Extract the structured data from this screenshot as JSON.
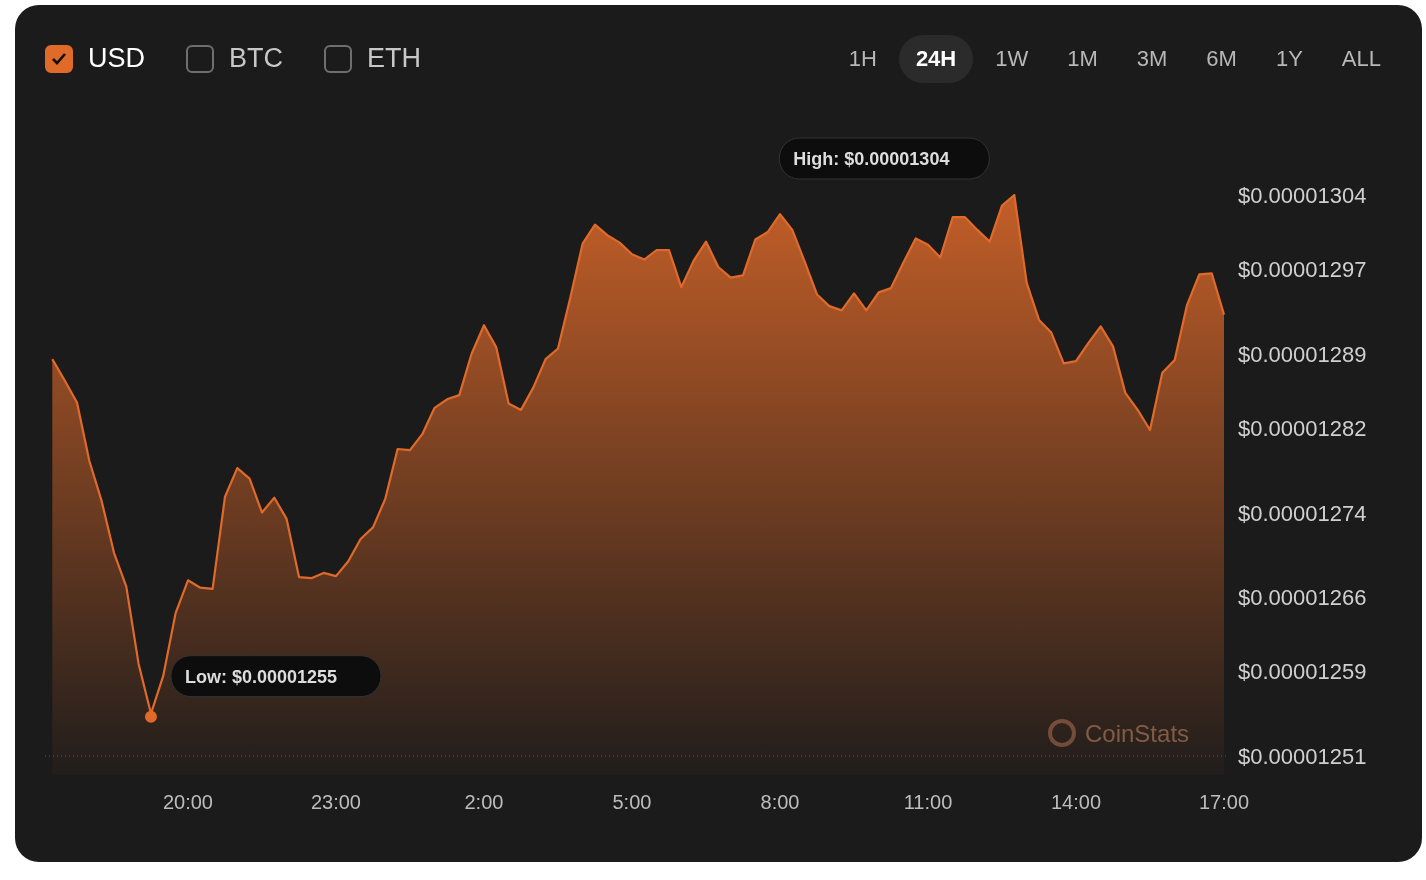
{
  "currencies": [
    {
      "label": "USD",
      "checked": true
    },
    {
      "label": "BTC",
      "checked": false
    },
    {
      "label": "ETH",
      "checked": false
    }
  ],
  "ranges": [
    {
      "label": "1H",
      "selected": false
    },
    {
      "label": "24H",
      "selected": true
    },
    {
      "label": "1W",
      "selected": false
    },
    {
      "label": "1M",
      "selected": false
    },
    {
      "label": "3M",
      "selected": false
    },
    {
      "label": "6M",
      "selected": false
    },
    {
      "label": "1Y",
      "selected": false
    },
    {
      "label": "ALL",
      "selected": false
    }
  ],
  "chart": {
    "watermark": "CoinStats",
    "chart_data": {
      "type": "area",
      "ylim": [
        1.251e-05,
        1.304e-05
      ],
      "categories": [
        null,
        null,
        null,
        null,
        null,
        null,
        null,
        null,
        null,
        null,
        null,
        "20:00",
        null,
        null,
        null,
        null,
        null,
        null,
        null,
        null,
        null,
        null,
        null,
        "23:00",
        null,
        null,
        null,
        null,
        null,
        null,
        null,
        null,
        null,
        null,
        null,
        "2:00",
        null,
        null,
        null,
        null,
        null,
        null,
        null,
        null,
        null,
        null,
        null,
        "5:00",
        null,
        null,
        null,
        null,
        null,
        null,
        null,
        null,
        null,
        null,
        null,
        "8:00",
        null,
        null,
        null,
        null,
        null,
        null,
        null,
        null,
        null,
        null,
        null,
        "11:00",
        null,
        null,
        null,
        null,
        null,
        null,
        null,
        null,
        null,
        null,
        null,
        "14:00",
        null,
        null,
        null,
        null,
        null,
        null,
        null,
        null,
        null,
        null,
        null,
        "17:00"
      ],
      "yticks": [
        {
          "value": 1.251e-05,
          "label": "$0.00001251"
        },
        {
          "value": 1.259e-05,
          "label": "$0.00001259"
        },
        {
          "value": 1.266e-05,
          "label": "$0.00001266"
        },
        {
          "value": 1.274e-05,
          "label": "$0.00001274"
        },
        {
          "value": 1.282e-05,
          "label": "$0.00001282"
        },
        {
          "value": 1.289e-05,
          "label": "$0.00001289"
        },
        {
          "value": 1.297e-05,
          "label": "$0.00001297"
        },
        {
          "value": 1.304e-05,
          "label": "$0.00001304"
        }
      ],
      "series": [
        {
          "color": "#e06a2a",
          "values": [
            1.2885e-05,
            1.2865e-05,
            1.2844e-05,
            1.2789e-05,
            1.2751e-05,
            1.2702e-05,
            1.267e-05,
            1.2597e-05,
            1.255e-05,
            1.2586e-05,
            1.2645e-05,
            1.2676e-05,
            1.2669e-05,
            1.2668e-05,
            1.2755e-05,
            1.2782e-05,
            1.2772e-05,
            1.274e-05,
            1.2754e-05,
            1.2734e-05,
            1.2679e-05,
            1.2678e-05,
            1.2683e-05,
            1.268e-05,
            1.2694e-05,
            1.2715e-05,
            1.2726e-05,
            1.2753e-05,
            1.28e-05,
            1.2799e-05,
            1.2814e-05,
            1.2839e-05,
            1.2847e-05,
            1.2851e-05,
            1.289e-05,
            1.2917e-05,
            1.2896e-05,
            1.2843e-05,
            1.2837e-05,
            1.2858e-05,
            1.2885e-05,
            1.2895e-05,
            1.2943e-05,
            1.2994e-05,
            1.3012e-05,
            1.3002e-05,
            1.2995e-05,
            1.2984e-05,
            1.2979e-05,
            1.2988e-05,
            1.2988e-05,
            1.2953e-05,
            1.2978e-05,
            1.2996e-05,
            1.2972e-05,
            1.2962e-05,
            1.2964e-05,
            1.2998e-05,
            1.3005e-05,
            1.3022e-05,
            1.3007e-05,
            1.2977e-05,
            1.2946e-05,
            1.2935e-05,
            1.2931e-05,
            1.2947e-05,
            1.2931e-05,
            1.2948e-05,
            1.2952e-05,
            1.2976e-05,
            1.2999e-05,
            1.2993e-05,
            1.2981e-05,
            1.3019e-05,
            1.3019e-05,
            1.3007e-05,
            1.2996e-05,
            1.303e-05,
            1.304e-05,
            1.2957e-05,
            1.2922e-05,
            1.291e-05,
            1.2881e-05,
            1.2883e-05,
            1.29e-05,
            1.2916e-05,
            1.2897e-05,
            1.2853e-05,
            1.2837e-05,
            1.2818e-05,
            1.2872e-05,
            1.2884e-05,
            1.2936e-05,
            1.2965e-05,
            1.2966e-05,
            1.2927e-05
          ]
        }
      ],
      "annotations": [
        "High: $0.00001304",
        "Low: $0.00001255"
      ]
    }
  }
}
